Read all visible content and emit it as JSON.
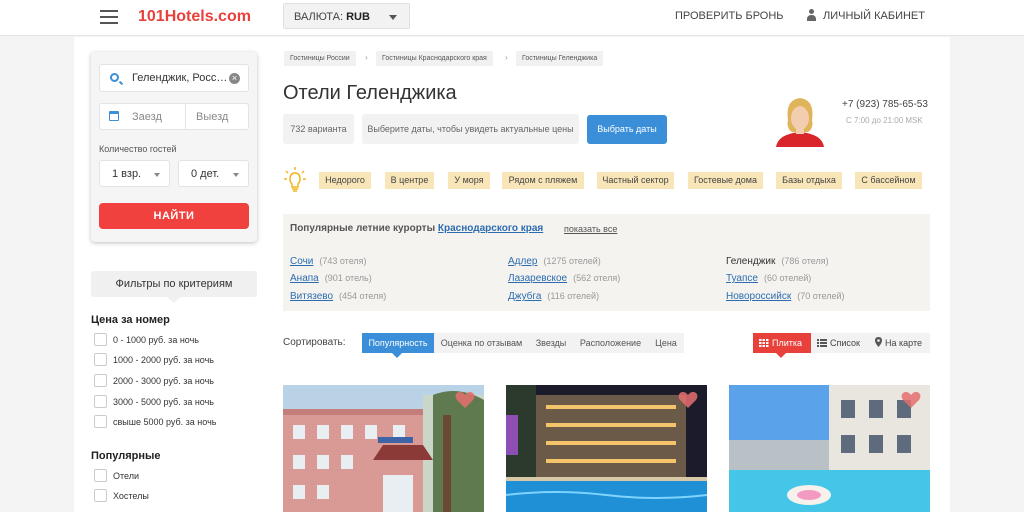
{
  "header": {
    "logo": "101Hotels.com",
    "currency_label": "ВАЛЮТА:",
    "currency_value": "RUB",
    "check_booking": "ПРОВЕРИТЬ БРОНЬ",
    "cabinet": "ЛИЧНЫЙ КАБИНЕТ"
  },
  "search": {
    "city": "Геленджик, Росс…",
    "checkin_placeholder": "Заезд",
    "checkout_placeholder": "Выезд",
    "guests_label": "Количество гостей",
    "adults": "1 взр.",
    "children": "0 дет.",
    "find_button": "НАЙТИ"
  },
  "filters": {
    "title": "Фильтры по критериям",
    "price_heading": "Цена за номер",
    "price_options": [
      "0 - 1000 руб. за ночь",
      "1000 - 2000 руб. за ночь",
      "2000 - 3000 руб. за ночь",
      "3000 - 5000 руб. за ночь",
      "свыше 5000 руб. за ночь"
    ],
    "popular_heading": "Популярные",
    "popular_options": [
      "Отели",
      "Хостелы"
    ]
  },
  "breadcrumbs": [
    "Гостиницы России",
    "Гостиницы Краснодарского края",
    "Гостиницы Геленджика"
  ],
  "page": {
    "title": "Отели Геленджика",
    "count": "732 варианта",
    "hint": "Выберите даты, чтобы увидеть актуальные цены",
    "choose_dates": "Выбрать даты",
    "phone": "+7 (923) 785-65-53",
    "hours": "С 7:00 до 21:00 MSK"
  },
  "tags": [
    "Недорого",
    "В центре",
    "У моря",
    "Рядом с пляжем",
    "Частный сектор",
    "Гостевые дома",
    "Базы отдыха",
    "С бассейном"
  ],
  "resorts": {
    "title_prefix": "Популярные летние курорты",
    "title_link": "Краснодарского края",
    "show_all": "показать все",
    "items": [
      {
        "name": "Сочи",
        "count": "(743 отеля)"
      },
      {
        "name": "Адлер",
        "count": "(1275 отелей)"
      },
      {
        "name": "Геленджик",
        "count": "(786 отеля)"
      },
      {
        "name": "Анапа",
        "count": "(901 отель)"
      },
      {
        "name": "Лазаревское",
        "count": "(562 отеля)"
      },
      {
        "name": "Туапсе",
        "count": "(60 отелей)"
      },
      {
        "name": "Витязево",
        "count": "(454 отеля)"
      },
      {
        "name": "Джубга",
        "count": "(116 отелей)"
      },
      {
        "name": "Новороссийск",
        "count": "(70 отелей)"
      }
    ]
  },
  "sort": {
    "label": "Сортировать:",
    "options": [
      "Популярность",
      "Оценка по отзывам",
      "Звезды",
      "Расположение",
      "Цена"
    ],
    "views": [
      "Плитка",
      "Список",
      "На карте"
    ]
  },
  "colors": {
    "brand_red": "#e8403a",
    "accent_blue": "#3a8fd8",
    "tag_yellow": "#f8e6b8"
  }
}
